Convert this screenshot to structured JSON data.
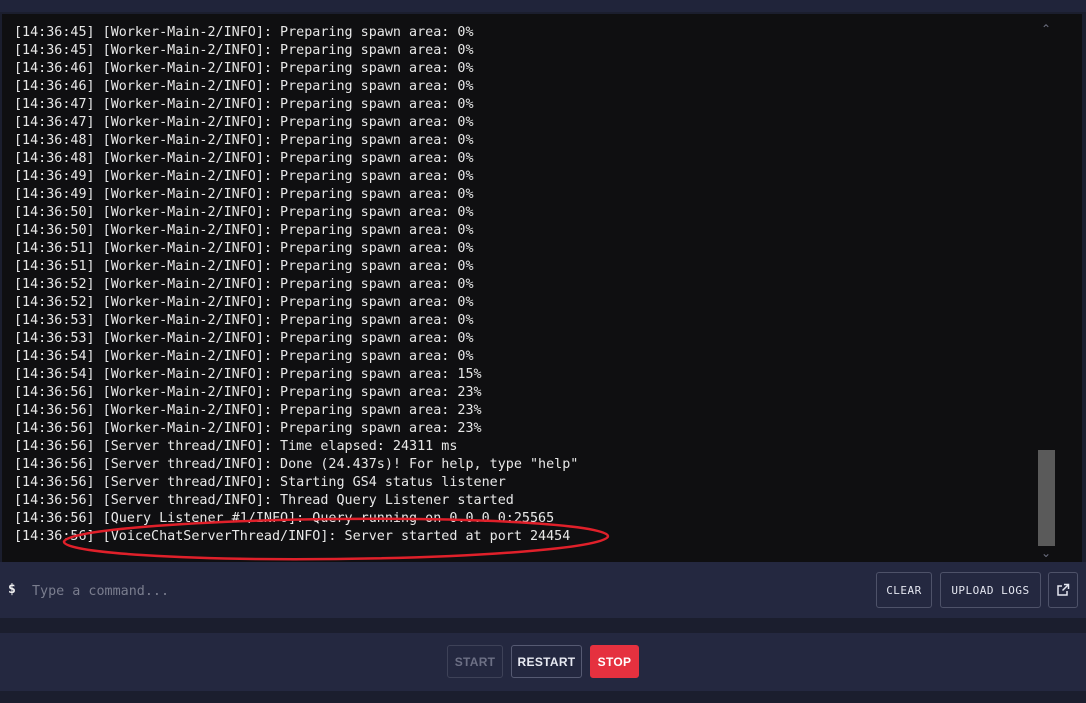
{
  "console": {
    "lines": [
      "[14:36:45] [Worker-Main-2/INFO]: Preparing spawn area: 0%",
      "[14:36:45] [Worker-Main-2/INFO]: Preparing spawn area: 0%",
      "[14:36:46] [Worker-Main-2/INFO]: Preparing spawn area: 0%",
      "[14:36:46] [Worker-Main-2/INFO]: Preparing spawn area: 0%",
      "[14:36:47] [Worker-Main-2/INFO]: Preparing spawn area: 0%",
      "[14:36:47] [Worker-Main-2/INFO]: Preparing spawn area: 0%",
      "[14:36:48] [Worker-Main-2/INFO]: Preparing spawn area: 0%",
      "[14:36:48] [Worker-Main-2/INFO]: Preparing spawn area: 0%",
      "[14:36:49] [Worker-Main-2/INFO]: Preparing spawn area: 0%",
      "[14:36:49] [Worker-Main-2/INFO]: Preparing spawn area: 0%",
      "[14:36:50] [Worker-Main-2/INFO]: Preparing spawn area: 0%",
      "[14:36:50] [Worker-Main-2/INFO]: Preparing spawn area: 0%",
      "[14:36:51] [Worker-Main-2/INFO]: Preparing spawn area: 0%",
      "[14:36:51] [Worker-Main-2/INFO]: Preparing spawn area: 0%",
      "[14:36:52] [Worker-Main-2/INFO]: Preparing spawn area: 0%",
      "[14:36:52] [Worker-Main-2/INFO]: Preparing spawn area: 0%",
      "[14:36:53] [Worker-Main-2/INFO]: Preparing spawn area: 0%",
      "[14:36:53] [Worker-Main-2/INFO]: Preparing spawn area: 0%",
      "[14:36:54] [Worker-Main-2/INFO]: Preparing spawn area: 0%",
      "[14:36:54] [Worker-Main-2/INFO]: Preparing spawn area: 15%",
      "[14:36:56] [Worker-Main-2/INFO]: Preparing spawn area: 23%",
      "[14:36:56] [Worker-Main-2/INFO]: Preparing spawn area: 23%",
      "[14:36:56] [Worker-Main-2/INFO]: Preparing spawn area: 23%",
      "[14:36:56] [Server thread/INFO]: Time elapsed: 24311 ms",
      "[14:36:56] [Server thread/INFO]: Done (24.437s)! For help, type \"help\"",
      "[14:36:56] [Server thread/INFO]: Starting GS4 status listener",
      "[14:36:56] [Server thread/INFO]: Thread Query Listener started",
      "[14:36:56] [Query Listener #1/INFO]: Query running on 0.0.0.0:25565",
      "[14:36:56] [VoiceChatServerThread/INFO]: Server started at port 24454"
    ],
    "scroll_position": 1.0
  },
  "command": {
    "prompt": "$",
    "placeholder": "Type a command..."
  },
  "toolbar": {
    "clear_label": "CLEAR",
    "upload_label": "UPLOAD LOGS"
  },
  "power": {
    "start_label": "START",
    "restart_label": "RESTART",
    "stop_label": "STOP"
  },
  "colors": {
    "stop": "#e5313f",
    "annotation": "#e0202a",
    "console_bg": "#0f0f11"
  },
  "icons": {
    "popout": "external-link-icon",
    "scroll_up": "chevron-up-icon",
    "scroll_down": "chevron-down-icon"
  }
}
